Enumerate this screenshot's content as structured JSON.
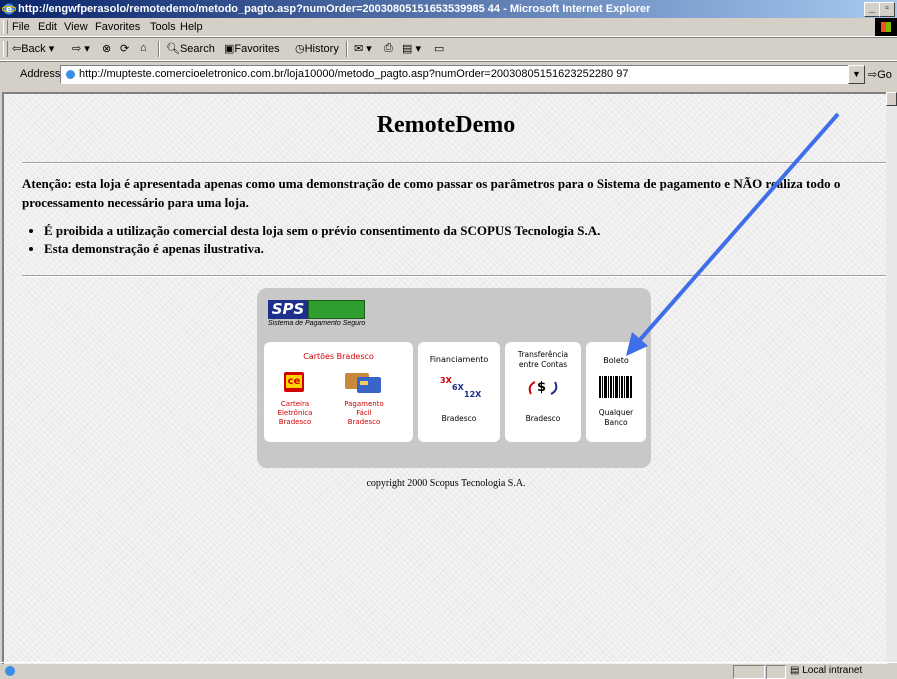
{
  "window": {
    "title": "http://engwfperasolo/remotedemo/metodo_pagto.asp?numOrder=20030805151653539985 44 - Microsoft Internet Explorer"
  },
  "menu": [
    "File",
    "Edit",
    "View",
    "Favorites",
    "Tools",
    "Help"
  ],
  "toolbar": {
    "back": "Back",
    "search": "Search",
    "favorites": "Favorites",
    "history": "History"
  },
  "address": {
    "label": "Address",
    "url": "http://mupteste.comercioeletronico.com.br/loja10000/metodo_pagto.asp?numOrder=20030805151623252280 97",
    "go": "Go"
  },
  "page": {
    "title": "RemoteDemo",
    "notice": "Atenção: esta loja é apresentada apenas como uma demonstração de como passar os parâmetros para o Sistema de pagamento e NÃO realiza todo o processamento necessário para uma loja.",
    "bullets": [
      "É proibida a utilização comercial desta loja sem o prévio consentimento da SCOPUS Tecnologia S.A.",
      "Esta demonstração é apenas ilustrativa."
    ],
    "copyright": "copyright 2000 Scopus Tecnologia S.A."
  },
  "sps": {
    "logo_text": "SPS",
    "logo_subtitle": "Sistema de Pagamento Seguro",
    "cartoes": {
      "title": "Cartões Bradesco",
      "ce_label": "ce",
      "carteira": [
        "Carteira",
        "Eletrônica",
        "Bradesco"
      ],
      "pagamento": [
        "Pagamento",
        "Fácil",
        "Bradesco"
      ]
    },
    "financiamento": {
      "title": "Financiamento",
      "icon_3x": "3X",
      "icon_6x": "6X",
      "icon_12x": "12X",
      "bank": "Bradesco"
    },
    "transferencia": {
      "title": [
        "Transferência",
        "entre Contas"
      ],
      "icon": "$",
      "bank": "Bradesco"
    },
    "boleto": {
      "title": "Boleto",
      "bank": [
        "Qualquer",
        "Banco"
      ]
    }
  },
  "status": {
    "zone": "Local intranet"
  },
  "colors": {
    "red_label": "#d00000",
    "arrow": "#3f6fe8",
    "sps_blue": "#1e2e8c",
    "sps_green": "#2e9e2e"
  }
}
